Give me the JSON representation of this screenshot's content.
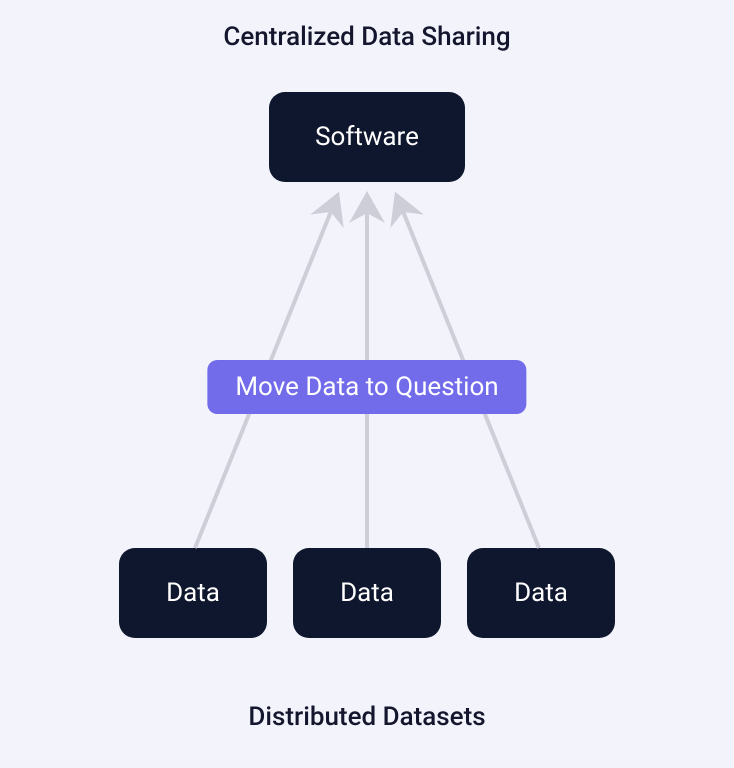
{
  "diagram": {
    "title_top": "Centralized Data Sharing",
    "title_bottom": "Distributed Datasets",
    "software_label": "Software",
    "middle_label": "Move Data to Question",
    "data_boxes": {
      "box1": "Data",
      "box2": "Data",
      "box3": "Data"
    },
    "colors": {
      "background": "#f2f3fb",
      "dark_box": "#0f172e",
      "accent": "#726bea",
      "arrow": "#cdced8",
      "text_dark": "#14162e"
    }
  }
}
